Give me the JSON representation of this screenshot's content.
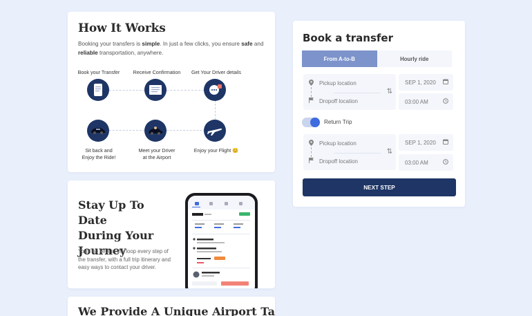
{
  "how_it_works": {
    "title": "How It Works",
    "intro_1": "Booking your transfers is ",
    "intro_bold_1": "simple",
    "intro_2": ". In just a few clicks, you ensure ",
    "intro_bold_2": "safe",
    "intro_3": " and ",
    "intro_bold_3": "reliable",
    "intro_4": " transportation, anywhere.",
    "steps": [
      {
        "label": "Book your Transfer",
        "icon": "document-icon"
      },
      {
        "label": "Receive Confirmation",
        "icon": "receipt-icon"
      },
      {
        "label": "Get Your Driver details",
        "icon": "driver-chat-icon"
      },
      {
        "label_1": "Sit back and",
        "label_2": "Enjoy the Ride!",
        "icon": "car-icon"
      },
      {
        "label_1": "Meet your Driver",
        "label_2": "at the Airport",
        "icon": "driver-car-icon"
      },
      {
        "label": "Enjoy your Flight 😊",
        "icon": "airplane-icon"
      }
    ]
  },
  "stay_updated": {
    "title_1": "Stay Up To Date",
    "title_2": "During Your",
    "title_3": "Journey",
    "desc": "You'll be kept in the loop  every step of the transfer, with a full trip itinerary and easy ways to contact your driver."
  },
  "provide": {
    "title": "We Provide A Unique Airport Taxi"
  },
  "booking": {
    "title": "Book a transfer",
    "tabs": [
      {
        "label": "From A-to-B",
        "active": true
      },
      {
        "label": "Hourly ride",
        "active": false
      }
    ],
    "outbound": {
      "pickup_placeholder": "Pickup location",
      "dropoff_placeholder": "Dropoff location",
      "date": "SEP 1, 2020",
      "time": "03:00 AM"
    },
    "return_trip_label": "Return Trip",
    "return_trip_on": true,
    "return": {
      "pickup_placeholder": "Pickup location",
      "dropoff_placeholder": "Dropoff location",
      "date": "SEP 1, 2020",
      "time": "03:00 AM"
    },
    "next_label": "NEXT STEP"
  },
  "colors": {
    "background": "#e9effb",
    "navy": "#1e3566",
    "tab_active": "#7c93cb",
    "toggle_knob": "#3f6be0"
  }
}
